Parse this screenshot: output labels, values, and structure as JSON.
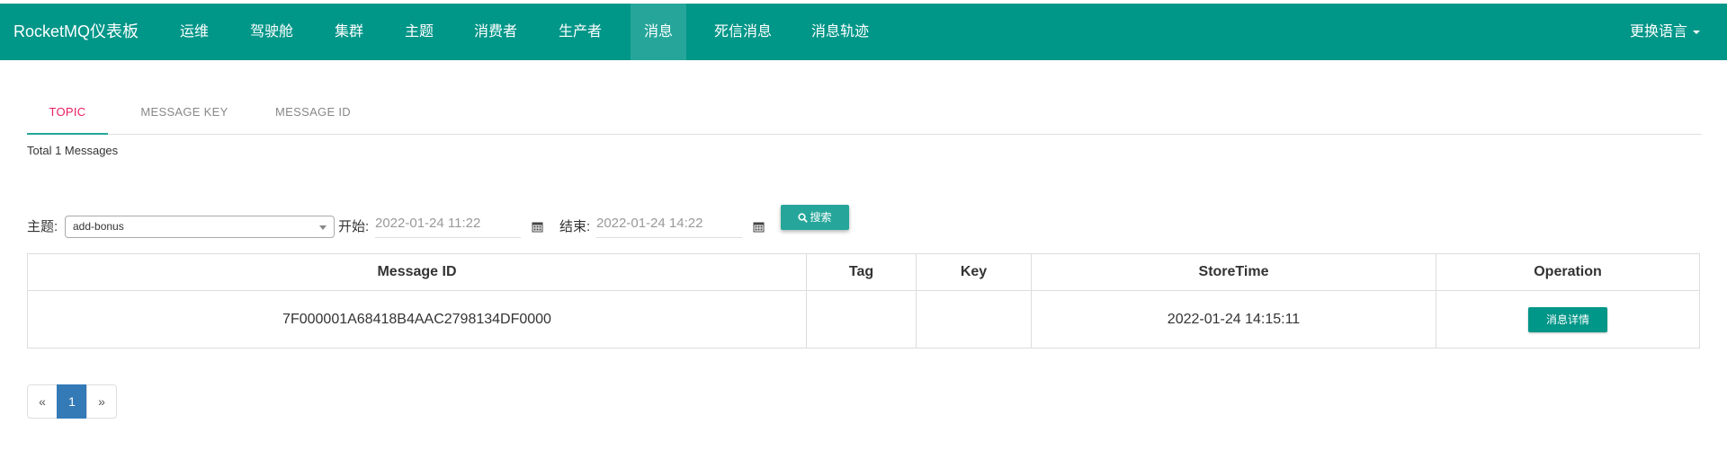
{
  "navbar": {
    "brand": "RocketMQ仪表板",
    "items": [
      "运维",
      "驾驶舱",
      "集群",
      "主题",
      "消费者",
      "生产者",
      "消息",
      "死信消息",
      "消息轨迹"
    ],
    "active_index": 6,
    "language": "更换语言"
  },
  "tabs": {
    "items": [
      "TOPIC",
      "MESSAGE KEY",
      "MESSAGE ID"
    ],
    "active_index": 0
  },
  "summary": "Total 1 Messages",
  "query": {
    "topic_label": "主题:",
    "topic_value": "add-bonus",
    "start_label": "开始:",
    "start_value": "2022-01-24 11:22",
    "end_label": "结束:",
    "end_value": "2022-01-24 14:22",
    "search_label": "搜索"
  },
  "table": {
    "headers": [
      "Message ID",
      "Tag",
      "Key",
      "StoreTime",
      "Operation"
    ],
    "rows": [
      {
        "message_id": "7F000001A68418B4AAC2798134DF0000",
        "tag": "",
        "key": "",
        "store_time": "2022-01-24 14:15:11",
        "action": "消息详情"
      }
    ]
  },
  "pagination": {
    "prev": "«",
    "pages": [
      "1"
    ],
    "current": "1",
    "next": "»"
  },
  "colors": {
    "navbar": "#009688",
    "navbar_active": "#26a69a",
    "tab_active_text": "#e91e63",
    "tab_indicator": "#26a69a",
    "page_active": "#337ab7"
  }
}
